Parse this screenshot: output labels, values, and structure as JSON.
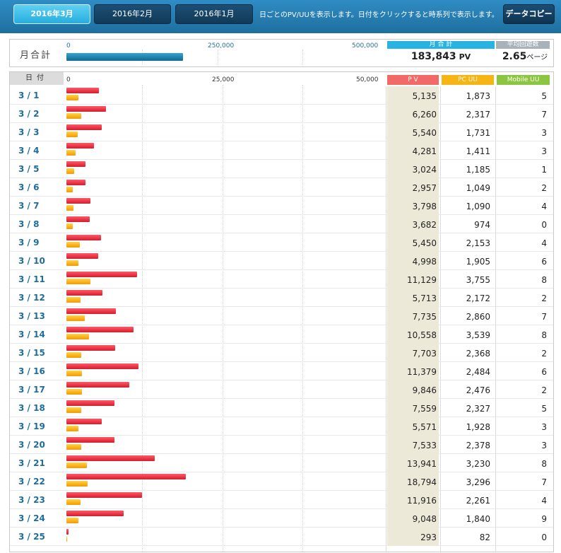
{
  "header": {
    "tabs": [
      {
        "label": "2016年3月",
        "active": true
      },
      {
        "label": "2016年2月",
        "active": false
      },
      {
        "label": "2016年1月",
        "active": false
      }
    ],
    "hint": "日ごとのPV/UUを表示します。日付をクリックすると時系列で表示します。",
    "copy_label": "データコピー"
  },
  "monthly": {
    "label": "月合計",
    "axis_ticks": [
      "0",
      "250,000",
      "500,000"
    ],
    "axis_max": 500000,
    "total_pv": 183843,
    "pv_total_head": "月 合 計",
    "pv_total_value": "183,843",
    "pv_unit": "PV",
    "avg_head": "平均回遊数",
    "avg_value": "2.65",
    "avg_unit": "ページ"
  },
  "daily": {
    "date_head": "日付",
    "axis_ticks": [
      "0",
      "25,000",
      "50,000"
    ],
    "axis_max": 50000,
    "pv_head": "P V",
    "pc_head": "PC UU",
    "mobile_head": "Mobile UU",
    "colors": {
      "pv": "#e02232",
      "uu": "#f5a100"
    },
    "rows": [
      {
        "date": "3 / 1",
        "pv": 5135,
        "pc": 1873,
        "mobile": 5,
        "pv_text": "5,135",
        "pc_text": "1,873",
        "mobile_text": "5"
      },
      {
        "date": "3 / 2",
        "pv": 6260,
        "pc": 2317,
        "mobile": 7,
        "pv_text": "6,260",
        "pc_text": "2,317",
        "mobile_text": "7"
      },
      {
        "date": "3 / 3",
        "pv": 5540,
        "pc": 1731,
        "mobile": 3,
        "pv_text": "5,540",
        "pc_text": "1,731",
        "mobile_text": "3"
      },
      {
        "date": "3 / 4",
        "pv": 4281,
        "pc": 1411,
        "mobile": 3,
        "pv_text": "4,281",
        "pc_text": "1,411",
        "mobile_text": "3"
      },
      {
        "date": "3 / 5",
        "pv": 3024,
        "pc": 1185,
        "mobile": 1,
        "pv_text": "3,024",
        "pc_text": "1,185",
        "mobile_text": "1"
      },
      {
        "date": "3 / 6",
        "pv": 2957,
        "pc": 1049,
        "mobile": 2,
        "pv_text": "2,957",
        "pc_text": "1,049",
        "mobile_text": "2"
      },
      {
        "date": "3 / 7",
        "pv": 3798,
        "pc": 1090,
        "mobile": 4,
        "pv_text": "3,798",
        "pc_text": "1,090",
        "mobile_text": "4"
      },
      {
        "date": "3 / 8",
        "pv": 3682,
        "pc": 974,
        "mobile": 0,
        "pv_text": "3,682",
        "pc_text": "974",
        "mobile_text": "0"
      },
      {
        "date": "3 / 9",
        "pv": 5450,
        "pc": 2153,
        "mobile": 4,
        "pv_text": "5,450",
        "pc_text": "2,153",
        "mobile_text": "4"
      },
      {
        "date": "3 / 10",
        "pv": 4998,
        "pc": 1905,
        "mobile": 6,
        "pv_text": "4,998",
        "pc_text": "1,905",
        "mobile_text": "6"
      },
      {
        "date": "3 / 11",
        "pv": 11129,
        "pc": 3755,
        "mobile": 8,
        "pv_text": "11,129",
        "pc_text": "3,755",
        "mobile_text": "8"
      },
      {
        "date": "3 / 12",
        "pv": 5713,
        "pc": 2172,
        "mobile": 2,
        "pv_text": "5,713",
        "pc_text": "2,172",
        "mobile_text": "2"
      },
      {
        "date": "3 / 13",
        "pv": 7735,
        "pc": 2860,
        "mobile": 7,
        "pv_text": "7,735",
        "pc_text": "2,860",
        "mobile_text": "7"
      },
      {
        "date": "3 / 14",
        "pv": 10558,
        "pc": 3539,
        "mobile": 8,
        "pv_text": "10,558",
        "pc_text": "3,539",
        "mobile_text": "8"
      },
      {
        "date": "3 / 15",
        "pv": 7703,
        "pc": 2368,
        "mobile": 2,
        "pv_text": "7,703",
        "pc_text": "2,368",
        "mobile_text": "2"
      },
      {
        "date": "3 / 16",
        "pv": 11379,
        "pc": 2484,
        "mobile": 6,
        "pv_text": "11,379",
        "pc_text": "2,484",
        "mobile_text": "6"
      },
      {
        "date": "3 / 17",
        "pv": 9846,
        "pc": 2476,
        "mobile": 2,
        "pv_text": "9,846",
        "pc_text": "2,476",
        "mobile_text": "2"
      },
      {
        "date": "3 / 18",
        "pv": 7559,
        "pc": 2327,
        "mobile": 5,
        "pv_text": "7,559",
        "pc_text": "2,327",
        "mobile_text": "5"
      },
      {
        "date": "3 / 19",
        "pv": 5571,
        "pc": 1928,
        "mobile": 3,
        "pv_text": "5,571",
        "pc_text": "1,928",
        "mobile_text": "3"
      },
      {
        "date": "3 / 20",
        "pv": 7533,
        "pc": 2378,
        "mobile": 3,
        "pv_text": "7,533",
        "pc_text": "2,378",
        "mobile_text": "3"
      },
      {
        "date": "3 / 21",
        "pv": 13941,
        "pc": 3230,
        "mobile": 8,
        "pv_text": "13,941",
        "pc_text": "3,230",
        "mobile_text": "8"
      },
      {
        "date": "3 / 22",
        "pv": 18794,
        "pc": 3296,
        "mobile": 7,
        "pv_text": "18,794",
        "pc_text": "3,296",
        "mobile_text": "7"
      },
      {
        "date": "3 / 23",
        "pv": 11916,
        "pc": 2261,
        "mobile": 4,
        "pv_text": "11,916",
        "pc_text": "2,261",
        "mobile_text": "4"
      },
      {
        "date": "3 / 24",
        "pv": 9048,
        "pc": 1840,
        "mobile": 9,
        "pv_text": "9,048",
        "pc_text": "1,840",
        "mobile_text": "9"
      },
      {
        "date": "3 / 25",
        "pv": 293,
        "pc": 82,
        "mobile": 0,
        "pv_text": "293",
        "pc_text": "82",
        "mobile_text": "0"
      }
    ]
  }
}
